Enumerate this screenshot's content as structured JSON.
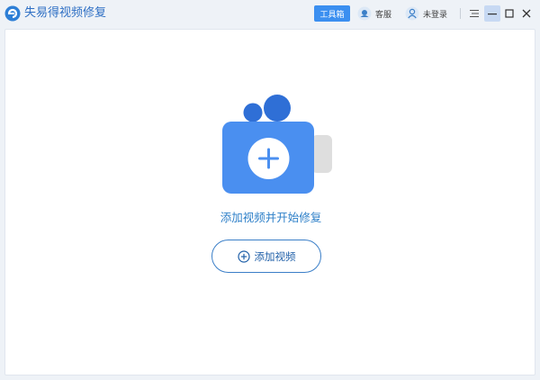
{
  "app": {
    "title": "失易得视频修复"
  },
  "header": {
    "toolbox_label": "工具箱",
    "customer_service_label": "客服",
    "login_label": "未登录"
  },
  "main": {
    "hint_text": "添加视频并开始修复",
    "add_button_label": "添加视频"
  },
  "colors": {
    "accent": "#3b8ff0",
    "camera_body": "#4a8ff0",
    "brand_dark": "#1f5fa8"
  },
  "icons": [
    "app-logo-icon",
    "customer-service-icon",
    "user-icon",
    "menu-icon",
    "minimize-icon",
    "maximize-icon",
    "close-icon",
    "add-video-camera-icon",
    "plus-circle-icon"
  ]
}
